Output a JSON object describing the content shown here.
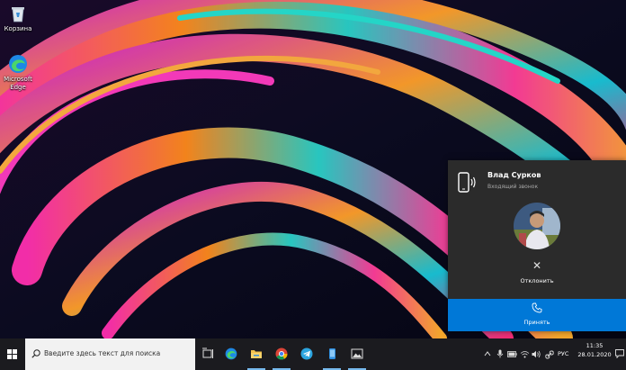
{
  "desktop": {
    "icons": [
      {
        "label": "Корзина",
        "icon": "recycle-bin-icon"
      },
      {
        "label": "Microsoft Edge",
        "icon": "edge-icon"
      }
    ]
  },
  "call_toast": {
    "caller_name": "Влад Сурков",
    "status": "Входящий звонок",
    "decline_label": "Отклонить",
    "accept_label": "Принять",
    "accent_color": "#0078d7"
  },
  "taskbar": {
    "search_placeholder": "Введите здесь текст для поиска",
    "apps": [
      "task-view-icon",
      "edge-icon",
      "file-explorer-icon",
      "chrome-icon",
      "telegram-icon",
      "your-phone-icon",
      "photos-icon"
    ],
    "language": "РУС",
    "time": "11:35",
    "date": "28.01.2020"
  }
}
